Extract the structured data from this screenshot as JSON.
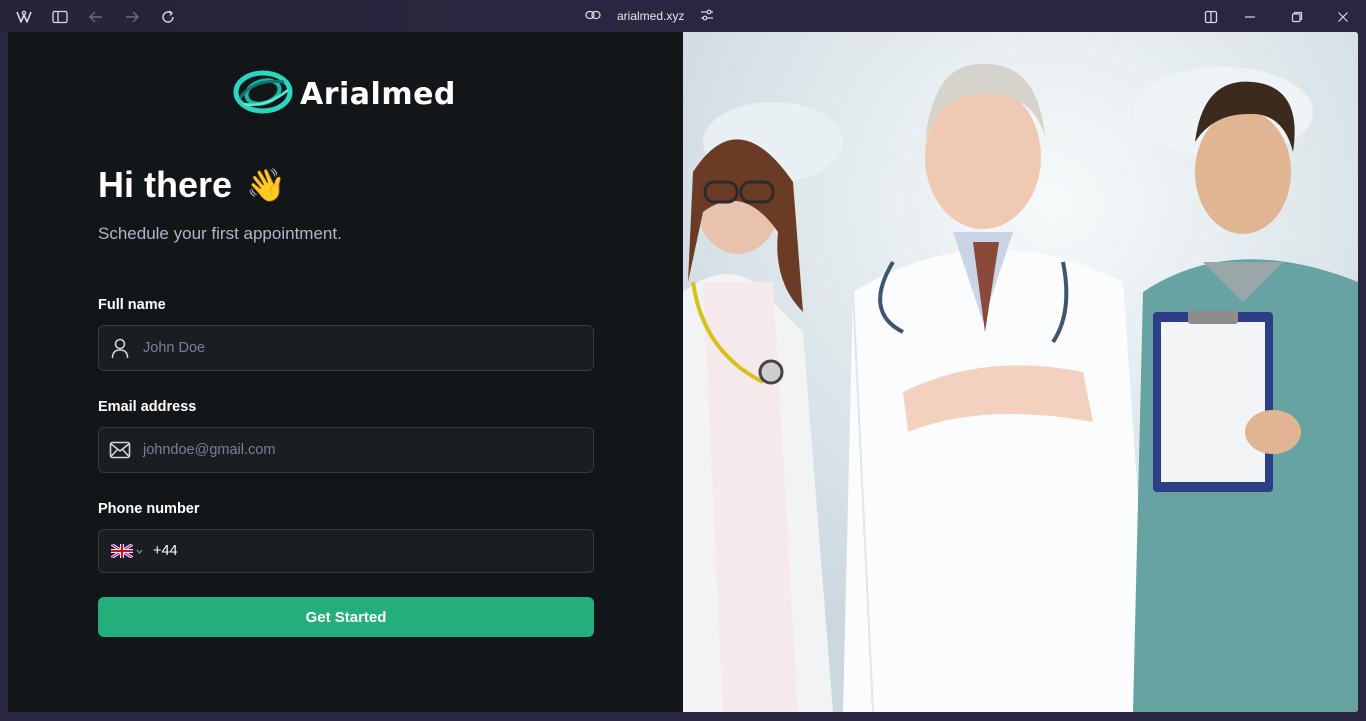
{
  "browser": {
    "url": "arialmed.xyz"
  },
  "brand": {
    "name": "Arialmed",
    "accent": "#24ae7c",
    "logo_color": "#2dd4bf"
  },
  "hero": {
    "title": "Hi there",
    "emoji": "👋",
    "subtitle": "Schedule your first appointment."
  },
  "form": {
    "full_name": {
      "label": "Full name",
      "placeholder": "John Doe",
      "icon": "user-icon"
    },
    "email": {
      "label": "Email address",
      "placeholder": "johndoe@gmail.com",
      "icon": "mail-icon"
    },
    "phone": {
      "label": "Phone number",
      "value": "+44",
      "country_icon": "uk-flag-icon"
    },
    "submit_label": "Get Started"
  },
  "illustration": {
    "subject": "doctors-photo"
  }
}
